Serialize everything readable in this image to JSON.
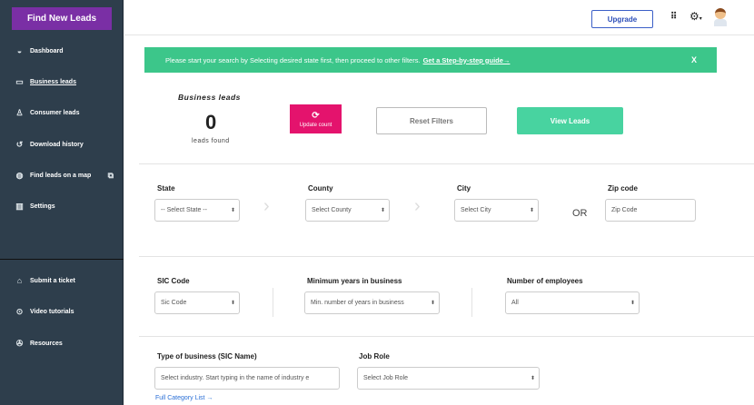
{
  "sidebar": {
    "find_button": "Find New Leads",
    "items": [
      {
        "label": "Dashboard",
        "icon": "dashboard-icon"
      },
      {
        "label": "Business leads",
        "icon": "briefcase-icon"
      },
      {
        "label": "Consumer leads",
        "icon": "user-icon"
      },
      {
        "label": "Download history",
        "icon": "history-icon"
      },
      {
        "label": "Find leads on a map",
        "icon": "globe-icon"
      },
      {
        "label": "Settings",
        "icon": "settings-icon"
      }
    ],
    "bottom_items": [
      {
        "label": "Submit a ticket",
        "icon": "ticket-icon"
      },
      {
        "label": "Video tutorials",
        "icon": "play-icon"
      },
      {
        "label": "Resources",
        "icon": "lifebuoy-icon"
      }
    ]
  },
  "topbar": {
    "upgrade": "Upgrade"
  },
  "banner": {
    "text": "Please start your search by Selecting desired state first, then proceed to other filters.",
    "link": "Get a Step-by-step guide→",
    "close": "X",
    "color": "#3cc68a"
  },
  "summary": {
    "title": "Business leads",
    "count": "0",
    "caption": "leads found",
    "update": "Update count",
    "reset": "Reset Filters",
    "view": "View Leads"
  },
  "location": {
    "state_label": "State",
    "state_value": "-- Select State --",
    "county_label": "County",
    "county_value": "Select County",
    "city_label": "City",
    "city_value": "Select City",
    "or": "OR",
    "zip_label": "Zip code",
    "zip_placeholder": "Zip Code"
  },
  "business": {
    "sic_label": "SIC Code",
    "sic_value": "Sic Code",
    "years_label": "Minimum years in business",
    "years_value": "Min. number of years in business",
    "emp_label": "Number of employees",
    "emp_value": "All"
  },
  "type": {
    "type_label": "Type of business (SIC Name)",
    "type_placeholder": "Select industry. Start typing in the name of industry e",
    "role_label": "Job Role",
    "role_value": "Select Job Role",
    "category_link": "Full Category List →"
  }
}
